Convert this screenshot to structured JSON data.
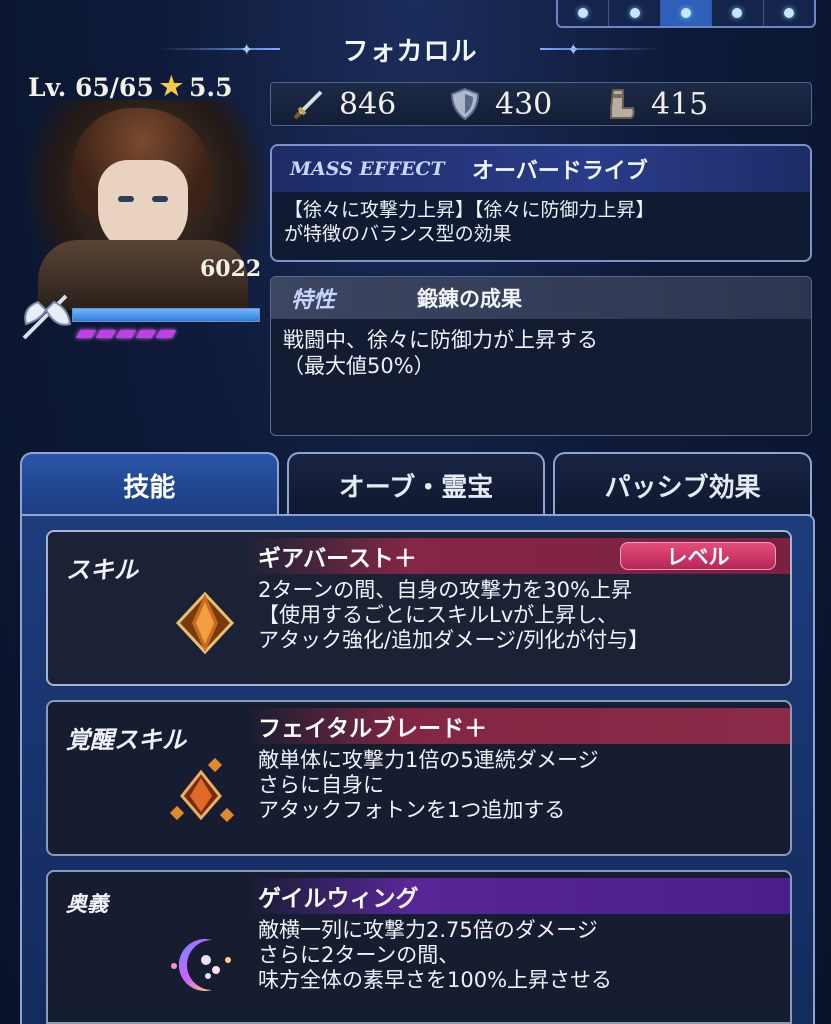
{
  "header": {
    "character_name": "フォカロル",
    "pager_pages": 5,
    "pager_active_index": 2
  },
  "profile": {
    "level": "Lv. 65/65",
    "rarity": "5.5",
    "power": "6022",
    "hp_fill": 1.0,
    "mp_pips": 5
  },
  "stats": {
    "attack": "846",
    "defense": "430",
    "speed": "415"
  },
  "mass_effect": {
    "tag": "MASS EFFECT",
    "name": "オーバードライブ",
    "desc_line1": "【徐々に攻撃力上昇】【徐々に防御力上昇】",
    "desc_line2": "が特徴のバランス型の効果"
  },
  "trait": {
    "tag": "特性",
    "name": "鍛錬の成果",
    "desc_line1": "戦闘中、徐々に防御力が上昇する",
    "desc_line2": "（最大値50%）"
  },
  "tabs": [
    {
      "label": "技能",
      "active": true
    },
    {
      "label": "オーブ・霊宝",
      "active": false
    },
    {
      "label": "パッシブ効果",
      "active": false
    }
  ],
  "skills": [
    {
      "type": "スキル",
      "name": "ギアバースト＋",
      "level_button": "レベル",
      "lines": [
        "2ターンの間、自身の攻撃力を30%上昇",
        "【使用するごとにスキルLvが上昇し、",
        "アタック強化/追加ダメージ/列化が付与】"
      ]
    },
    {
      "type": "覚醒スキル",
      "name": "フェイタルブレード＋",
      "lines": [
        "敵単体に攻撃力1倍の5連続ダメージ",
        "さらに自身に",
        "アタックフォトンを1つ追加する"
      ]
    },
    {
      "type": "奥義",
      "name": "ゲイルウィング",
      "lines": [
        "敵横一列に攻撃力2.75倍のダメージ",
        "さらに2ターンの間、",
        "味方全体の素早さを100%上昇させる"
      ]
    }
  ],
  "colors": {
    "accent_blue": "#2a55a8",
    "skill_red": "#8a2a48",
    "ultimate_purple": "#4a1e8a",
    "level_button": "#d63a6a"
  }
}
